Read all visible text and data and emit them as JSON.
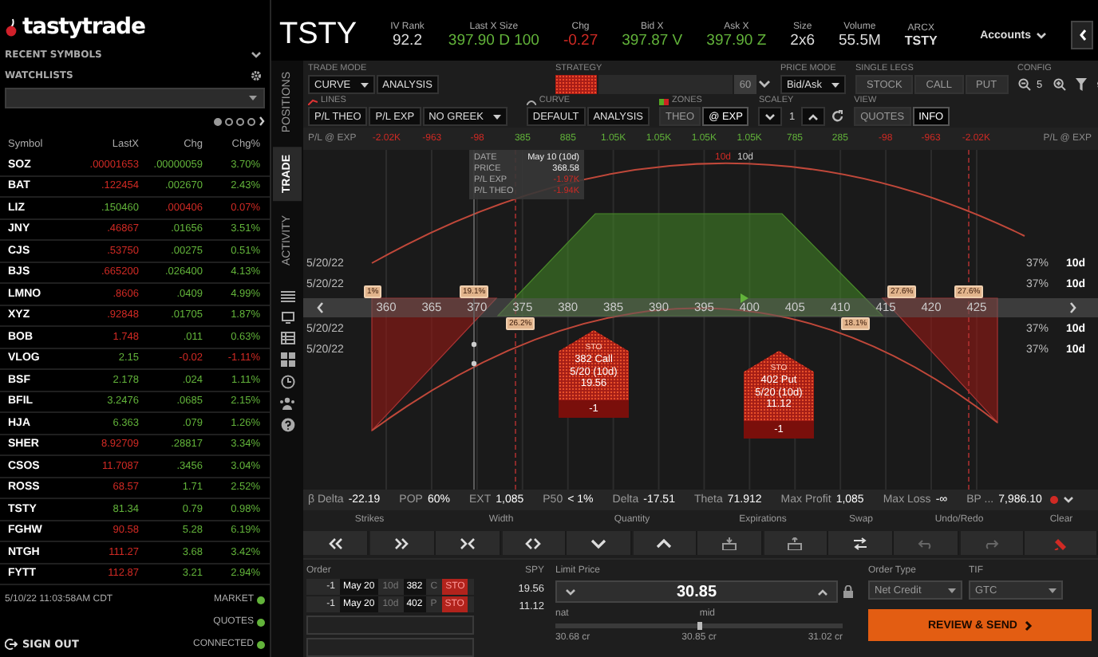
{
  "logo": "tastytrade",
  "sidebar": {
    "recent_symbols": "RECENT SYMBOLS",
    "watchlists": "WATCHLISTS",
    "pager": [
      {
        "selected": true
      },
      {
        "selected": false
      },
      {
        "selected": false
      },
      {
        "selected": false
      }
    ],
    "columns": [
      "Symbol",
      "LastX",
      "Chg",
      "Chg%"
    ],
    "rows": [
      {
        "symbol": "SOZ",
        "last": ".00001653",
        "last_up": false,
        "chg": ".00000059",
        "chg_pct": "3.70%",
        "chg_up": true
      },
      {
        "symbol": "BAT",
        "last": ".122454",
        "last_up": false,
        "chg": ".002670",
        "chg_pct": "2.43%",
        "chg_up": true
      },
      {
        "symbol": "LIZ",
        "last": ".150460",
        "last_up": true,
        "chg": ".000406",
        "chg_pct": "0.07%",
        "chg_up": false
      },
      {
        "symbol": "JNY",
        "last": ".46867",
        "last_up": false,
        "chg": ".01656",
        "chg_pct": "3.51%",
        "chg_up": true
      },
      {
        "symbol": "CJS",
        "last": ".53750",
        "last_up": false,
        "chg": ".00275",
        "chg_pct": "0.51%",
        "chg_up": true
      },
      {
        "symbol": "BJS",
        "last": ".665200",
        "last_up": false,
        "chg": ".026400",
        "chg_pct": "4.13%",
        "chg_up": true
      },
      {
        "symbol": "LMNO",
        "last": ".8606",
        "last_up": false,
        "chg": ".0409",
        "chg_pct": "4.99%",
        "chg_up": true
      },
      {
        "symbol": "XYZ",
        "last": ".92848",
        "last_up": false,
        "chg": ".01705",
        "chg_pct": "1.87%",
        "chg_up": true
      },
      {
        "symbol": "BOB",
        "last": "1.748",
        "last_up": false,
        "chg": ".011",
        "chg_pct": "0.63%",
        "chg_up": true
      },
      {
        "symbol": "VLOG",
        "last": "2.15",
        "last_up": true,
        "chg": "-0.02",
        "chg_pct": "-1.11%",
        "chg_up": false
      },
      {
        "symbol": "BSF",
        "last": "2.178",
        "last_up": true,
        "chg": ".024",
        "chg_pct": "1.11%",
        "chg_up": true
      },
      {
        "symbol": "BFIL",
        "last": "3.2476",
        "last_up": true,
        "chg": ".0685",
        "chg_pct": "2.15%",
        "chg_up": true
      },
      {
        "symbol": "HJA",
        "last": "6.363",
        "last_up": true,
        "chg": ".079",
        "chg_pct": "1.26%",
        "chg_up": true
      },
      {
        "symbol": "SHER",
        "last": "8.92709",
        "last_up": false,
        "chg": ".28817",
        "chg_pct": "3.34%",
        "chg_up": true
      },
      {
        "symbol": "CSOS",
        "last": "11.7087",
        "last_up": false,
        "chg": ".3456",
        "chg_pct": "3.04%",
        "chg_up": true
      },
      {
        "symbol": "ROSS",
        "last": "68.57",
        "last_up": false,
        "chg": "1.71",
        "chg_pct": "2.52%",
        "chg_up": true
      },
      {
        "symbol": "TSTY",
        "last": "81.34",
        "last_up": true,
        "chg": "0.79",
        "chg_pct": "0.98%",
        "chg_up": true
      },
      {
        "symbol": "FGHW",
        "last": "90.58",
        "last_up": false,
        "chg": "5.28",
        "chg_pct": "6.19%",
        "chg_up": true
      },
      {
        "symbol": "NTGH",
        "last": "111.27",
        "last_up": false,
        "chg": "3.68",
        "chg_pct": "3.42%",
        "chg_up": true
      },
      {
        "symbol": "FYTT",
        "last": "112.87",
        "last_up": false,
        "chg": "3.21",
        "chg_pct": "2.94%",
        "chg_up": true
      }
    ],
    "timestamp": "5/10/22 11:03:58AM CDT",
    "statuses": [
      {
        "label": "MARKET",
        "on": true
      },
      {
        "label": "QUOTES",
        "on": true
      },
      {
        "label": "CONNECTED",
        "on": true
      }
    ],
    "sign_out": "SIGN OUT"
  },
  "quote": {
    "symbol": "TSTY",
    "stats": [
      {
        "label": "IV Rank",
        "value": "92.2",
        "color": "#dddddd"
      },
      {
        "label": "Last X Size",
        "value": "397.90 D 100",
        "color": "#62b33a"
      },
      {
        "label": "Chg",
        "value": "-0.27",
        "color": "#d02a24"
      },
      {
        "label": "Bid X",
        "value": "397.87 V",
        "color": "#62b33a"
      },
      {
        "label": "Ask X",
        "value": "397.90 Z",
        "color": "#62b33a"
      },
      {
        "label": "Size",
        "value": "2x6",
        "color": "#dddddd"
      },
      {
        "label": "Volume",
        "value": "55.5M",
        "color": "#dddddd"
      },
      {
        "label": "ARCX",
        "value": "TSTY",
        "color": "#dddddd"
      }
    ],
    "accounts": "Accounts"
  },
  "side_tabs": [
    {
      "label": "POSITIONS",
      "selected": false
    },
    {
      "label": "TRADE",
      "selected": true
    },
    {
      "label": "ACTIVITY",
      "selected": false
    }
  ],
  "toolbar": {
    "trade_mode": {
      "label": "TRADE MODE",
      "dropdown": "CURVE",
      "button": "ANALYSIS"
    },
    "strategy": {
      "label": "STRATEGY",
      "value": "60"
    },
    "price_mode": {
      "label": "PRICE MODE",
      "dropdown": "Bid/Ask"
    },
    "single_legs": {
      "label": "SINGLE LEGS",
      "buttons": [
        "STOCK",
        "CALL",
        "PUT"
      ]
    },
    "config": {
      "label": "CONFIG",
      "zoom": "5"
    },
    "lines": {
      "label": "LINES",
      "buttons": [
        "P/L THEO",
        "P/L EXP"
      ],
      "dropdown": "NO GREEK"
    },
    "curve": {
      "label": "CURVE",
      "buttons": [
        "DEFAULT",
        "ANALYSIS"
      ]
    },
    "zones": {
      "label": "ZONES",
      "options": [
        {
          "label": "THEO",
          "selected": false
        },
        {
          "label": "@ EXP",
          "selected": true
        }
      ]
    },
    "scale_y": {
      "label": "SCALEY",
      "value": "1"
    },
    "view": {
      "label": "VIEW",
      "options": [
        {
          "label": "QUOTES",
          "selected": false
        },
        {
          "label": "INFO",
          "selected": true
        }
      ]
    }
  },
  "chart": {
    "header_labels": [
      "P/L @ EXP",
      "P/L @ EXP"
    ],
    "pl_at_exp": [
      {
        "value": "-2.02K",
        "profit": false
      },
      {
        "value": "-963",
        "profit": false
      },
      {
        "value": "-98",
        "profit": false
      },
      {
        "value": "385",
        "profit": true
      },
      {
        "value": "885",
        "profit": true
      },
      {
        "value": "1.05K",
        "profit": true
      },
      {
        "value": "1.05K",
        "profit": true
      },
      {
        "value": "1.05K",
        "profit": true
      },
      {
        "value": "1.05K",
        "profit": true
      },
      {
        "value": "785",
        "profit": true
      },
      {
        "value": "285",
        "profit": true
      },
      {
        "value": "-98",
        "profit": false
      },
      {
        "value": "-963",
        "profit": false
      },
      {
        "value": "-2.02K",
        "profit": false
      }
    ],
    "tooltip": [
      {
        "label": "DATE",
        "value": "May 10 (10d)",
        "loss": false
      },
      {
        "label": "PRICE",
        "value": "368.58",
        "loss": false
      },
      {
        "label": "P/L EXP",
        "value": "-1.97K",
        "loss": true
      },
      {
        "label": "P/L THEO",
        "value": "-1.94K",
        "loss": true
      }
    ],
    "curve_labels": [
      {
        "text": "10d",
        "loss": true
      },
      {
        "text": "10d",
        "loss": false
      }
    ],
    "strikes": [
      "360",
      "365",
      "370",
      "375",
      "380",
      "385",
      "390",
      "395",
      "400",
      "405",
      "410",
      "415",
      "420",
      "425"
    ],
    "expirations": [
      {
        "date": "5/20/22",
        "iv": "37%",
        "dte": "10d"
      },
      {
        "date": "5/20/22",
        "iv": "37%",
        "dte": "10d"
      },
      {
        "date": "5/20/22",
        "iv": "37%",
        "dte": "10d"
      },
      {
        "date": "5/20/22",
        "iv": "37%",
        "dte": "10d"
      }
    ],
    "probabilities": [
      "1%",
      "19.1%",
      "26.2%",
      "18.1%",
      "27.6%",
      "27.6%"
    ],
    "legs": [
      {
        "action": "STO",
        "title": "382 Call",
        "expiry": "5/20 (10d)",
        "price": "19.56",
        "quantity": "-1"
      },
      {
        "action": "STO",
        "title": "402 Put",
        "expiry": "5/20 (10d)",
        "price": "11.12",
        "quantity": "-1"
      }
    ]
  },
  "stats": [
    {
      "label": "β Delta",
      "value": "-22.19"
    },
    {
      "label": "POP",
      "value": "60%"
    },
    {
      "label": "EXT",
      "value": "1,085"
    },
    {
      "label": "P50",
      "value": "< 1%"
    },
    {
      "label": "Delta",
      "value": "-17.51"
    },
    {
      "label": "Theta",
      "value": "71.912"
    },
    {
      "label": "Max Profit",
      "value": "1,085"
    },
    {
      "label": "Max Loss",
      "value": "-∞"
    },
    {
      "label": "BP ...",
      "value": "7,986.10"
    }
  ],
  "controls": [
    "Strikes",
    "Width",
    "Quantity",
    "Expirations",
    "Swap",
    "Undo/Redo",
    "Clear"
  ],
  "order": {
    "label": "Order",
    "symbol": "SPY",
    "legs": [
      {
        "quantity": "-1",
        "month": "May 20",
        "dte": "10d",
        "strike": "382",
        "type": "C",
        "action": "STO",
        "price": "19.56"
      },
      {
        "quantity": "-1",
        "month": "May 20",
        "dte": "10d",
        "strike": "402",
        "type": "P",
        "action": "STO",
        "price": "11.12"
      }
    ],
    "limit_label": "Limit Price",
    "limit": "30.85",
    "nat_label": "nat",
    "mid_label": "mid",
    "level": 0.5,
    "nat": "30.68 cr",
    "mid": "30.85 cr",
    "far": "31.02 cr",
    "order_type_label": "Order Type",
    "order_type": "Net Credit",
    "tif_label": "TIF",
    "tif": "GTC",
    "submit": "REVIEW & SEND"
  }
}
